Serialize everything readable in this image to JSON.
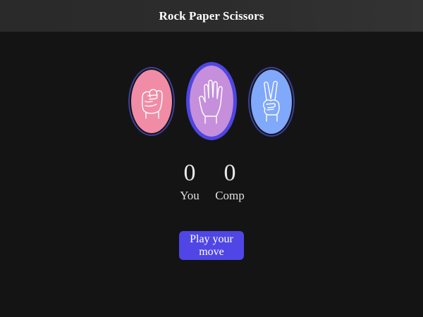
{
  "header": {
    "title": "Rock Paper Scissors"
  },
  "choices": [
    {
      "name": "rock",
      "icon": "rock-fist-icon",
      "color": "#f08ca6"
    },
    {
      "name": "paper",
      "icon": "paper-hand-icon",
      "color": "#c58fdc"
    },
    {
      "name": "scissors",
      "icon": "scissors-hand-icon",
      "color": "#80a8fb"
    }
  ],
  "scoreboard": {
    "you": {
      "score": "0",
      "label": "You"
    },
    "comp": {
      "score": "0",
      "label": "Comp"
    }
  },
  "actions": {
    "play_label": "Play your move"
  },
  "colors": {
    "background": "#141414",
    "header": "#2c2c2c",
    "accent": "#4f46e5",
    "ring": "#3c3f9e"
  }
}
